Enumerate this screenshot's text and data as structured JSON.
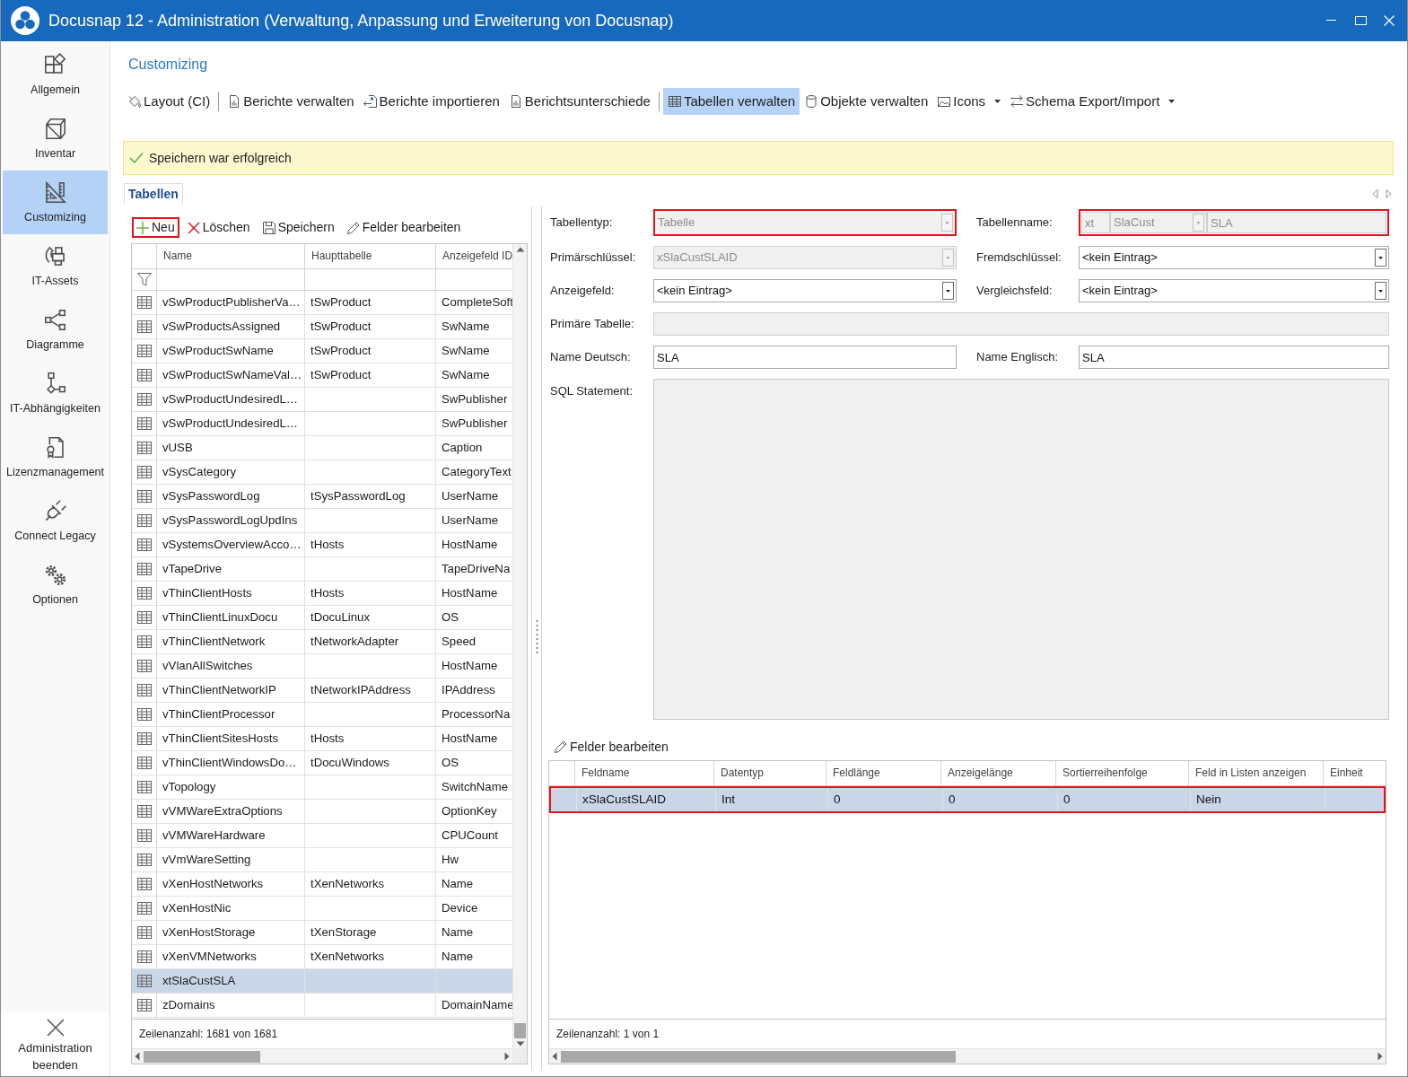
{
  "window": {
    "title": "Docusnap 12 - Administration (Verwaltung, Anpassung und Erweiterung von Docusnap)"
  },
  "sidebar": {
    "items": [
      {
        "label": "Allgemein",
        "selected": false
      },
      {
        "label": "Inventar",
        "selected": false
      },
      {
        "label": "Customizing",
        "selected": true
      },
      {
        "label": "IT-Assets",
        "selected": false
      },
      {
        "label": "Diagramme",
        "selected": false
      },
      {
        "label": "IT-Abhängigkeiten",
        "selected": false
      },
      {
        "label": "Lizenzmanagement",
        "selected": false
      },
      {
        "label": "Connect Legacy",
        "selected": false
      },
      {
        "label": "Optionen",
        "selected": false
      }
    ],
    "footer": {
      "label": "Administration beenden"
    }
  },
  "page": {
    "title": "Customizing"
  },
  "toolbar": {
    "groups": [
      [
        {
          "label": "Layout (CI)",
          "selected": false,
          "dropdown": false
        }
      ],
      [
        {
          "label": "Berichte verwalten",
          "selected": false,
          "dropdown": false
        },
        {
          "label": "Berichte importieren",
          "selected": false,
          "dropdown": false
        },
        {
          "label": "Berichtsunterschiede",
          "selected": false,
          "dropdown": false
        }
      ],
      [
        {
          "label": "Tabellen verwalten",
          "selected": true,
          "dropdown": false
        },
        {
          "label": "Objekte verwalten",
          "selected": false,
          "dropdown": false
        },
        {
          "label": "Icons",
          "selected": false,
          "dropdown": true
        },
        {
          "label": "Schema Export/Import",
          "selected": false,
          "dropdown": true
        }
      ]
    ]
  },
  "notification": {
    "text": "Speichern war erfolgreich"
  },
  "tabs": [
    {
      "label": "Tabellen",
      "selected": true
    }
  ],
  "table_panel": {
    "actions": [
      {
        "label": "Neu",
        "highlighted": true
      },
      {
        "label": "Löschen",
        "highlighted": false
      },
      {
        "label": "Speichern",
        "highlighted": false
      },
      {
        "label": "Felder bearbeiten",
        "highlighted": false
      }
    ],
    "table": {
      "columns": [
        "Name",
        "Haupttabelle",
        "Anzeigefeld ID"
      ],
      "rows": [
        {
          "name": "vSwProductPublisherVa…",
          "main_table": "tSwProduct",
          "display_field": "CompleteSoft",
          "selected": false
        },
        {
          "name": "vSwProductsAssigned",
          "main_table": "tSwProduct",
          "display_field": "SwName",
          "selected": false
        },
        {
          "name": "vSwProductSwName",
          "main_table": "tSwProduct",
          "display_field": "SwName",
          "selected": false
        },
        {
          "name": "vSwProductSwNameVal…",
          "main_table": "tSwProduct",
          "display_field": "SwName",
          "selected": false
        },
        {
          "name": "vSwProductUndesiredL…",
          "display_field": "SwPublisher",
          "selected": false
        },
        {
          "name": "vSwProductUndesiredL…",
          "display_field": "SwPublisher",
          "selected": false
        },
        {
          "name": "vUSB",
          "display_field": "Caption",
          "selected": false
        },
        {
          "name": "vSysCategory",
          "display_field": "CategoryText",
          "selected": false
        },
        {
          "name": "vSysPasswordLog",
          "main_table": "tSysPasswordLog",
          "display_field": "UserName",
          "selected": false
        },
        {
          "name": "vSysPasswordLogUpdIns",
          "display_field": "UserName",
          "selected": false
        },
        {
          "name": "vSystemsOverviewAcco…",
          "main_table": "tHosts",
          "display_field": "HostName",
          "selected": false
        },
        {
          "name": "vTapeDrive",
          "display_field": "TapeDriveNa",
          "selected": false
        },
        {
          "name": "vThinClientHosts",
          "main_table": "tHosts",
          "display_field": "HostName",
          "selected": false
        },
        {
          "name": "vThinClientLinuxDocu",
          "main_table": "tDocuLinux",
          "display_field": "OS",
          "selected": false
        },
        {
          "name": "vThinClientNetwork",
          "main_table": "tNetworkAdapter",
          "display_field": "Speed",
          "selected": false
        },
        {
          "name": "vVlanAllSwitches",
          "display_field": "HostName",
          "selected": false
        },
        {
          "name": "vThinClientNetworkIP",
          "main_table": "tNetworkIPAddress",
          "display_field": "IPAddress",
          "selected": false
        },
        {
          "name": "vThinClientProcessor",
          "display_field": "ProcessorNa",
          "selected": false
        },
        {
          "name": "vThinClientSitesHosts",
          "main_table": "tHosts",
          "display_field": "HostName",
          "selected": false
        },
        {
          "name": "vThinClientWindowsDo…",
          "main_table": "tDocuWindows",
          "display_field": "OS",
          "selected": false
        },
        {
          "name": "vTopology",
          "display_field": "SwitchName",
          "selected": false
        },
        {
          "name": "vVMWareExtraOptions",
          "display_field": "OptionKey",
          "selected": false
        },
        {
          "name": "vVMWareHardware",
          "display_field": "CPUCount",
          "selected": false
        },
        {
          "name": "vVmWareSetting",
          "display_field": "Hw",
          "selected": false
        },
        {
          "name": "vXenHostNetworks",
          "main_table": "tXenNetworks",
          "display_field": "Name",
          "selected": false
        },
        {
          "name": "vXenHostNic",
          "display_field": "Device",
          "selected": false
        },
        {
          "name": "vXenHostStorage",
          "main_table": "tXenStorage",
          "display_field": "Name",
          "selected": false
        },
        {
          "name": "vXenVMNetworks",
          "main_table": "tXenNetworks",
          "display_field": "Name",
          "selected": false
        },
        {
          "name": "xtSlaCustSLA",
          "selected": true
        },
        {
          "name": "zDomains",
          "display_field": "DomainName",
          "selected": false
        }
      ],
      "footer": "Zeilenanzahl: 1681 von 1681"
    }
  },
  "detail_panel": {
    "form": {
      "rows": [
        [
          {
            "label": "Tabellentyp:",
            "kind": "select",
            "value": "Tabelle",
            "disabled": true,
            "highlighted": true
          },
          {
            "label": "Tabellenname:",
            "kind": "composite",
            "disabled": true,
            "highlighted": true,
            "parts": [
              {
                "kind": "input",
                "value": "xt"
              },
              {
                "kind": "select",
                "value": "SlaCust"
              },
              {
                "kind": "input",
                "value": "SLA"
              }
            ]
          }
        ],
        [
          {
            "label": "Primärschlüssel:",
            "kind": "select",
            "value": "xSlaCustSLAID",
            "disabled": true,
            "highlighted": false
          },
          {
            "label": "Fremdschlüssel:",
            "kind": "select",
            "value": "<kein Eintrag>",
            "disabled": false,
            "highlighted": false
          }
        ],
        [
          {
            "label": "Anzeigefeld:",
            "kind": "select",
            "value": "<kein Eintrag>",
            "disabled": false,
            "highlighted": false
          },
          {
            "label": "Vergleichsfeld:",
            "kind": "select",
            "value": "<kein Eintrag>",
            "disabled": false,
            "highlighted": false
          }
        ],
        [
          {
            "label": "Primäre Tabelle:",
            "kind": "input",
            "disabled": true,
            "highlighted": false
          }
        ],
        [
          {
            "label": "Name Deutsch:",
            "kind": "input",
            "value": "SLA",
            "disabled": false,
            "highlighted": false
          },
          {
            "label": "Name Englisch:",
            "kind": "input",
            "value": "SLA",
            "disabled": false,
            "highlighted": false
          }
        ],
        [
          {
            "label": "SQL Statement:",
            "kind": "textarea",
            "disabled": true,
            "highlighted": false
          }
        ]
      ]
    },
    "fields": {
      "action": {
        "label": "Felder bearbeiten"
      },
      "table": {
        "columns": [
          "Feldname",
          "Datentyp",
          "Feldlänge",
          "Anzeigelänge",
          "Sortierreihenfolge",
          "Feld in Listen anzeigen",
          "Einheit"
        ],
        "rows": [
          {
            "cells": [
              "xSlaCustSLAID",
              "Int",
              "0",
              "0",
              "0",
              "Nein"
            ],
            "selected": true,
            "highlighted": true
          }
        ],
        "footer": "Zeilenanzahl: 1 von 1"
      }
    }
  }
}
